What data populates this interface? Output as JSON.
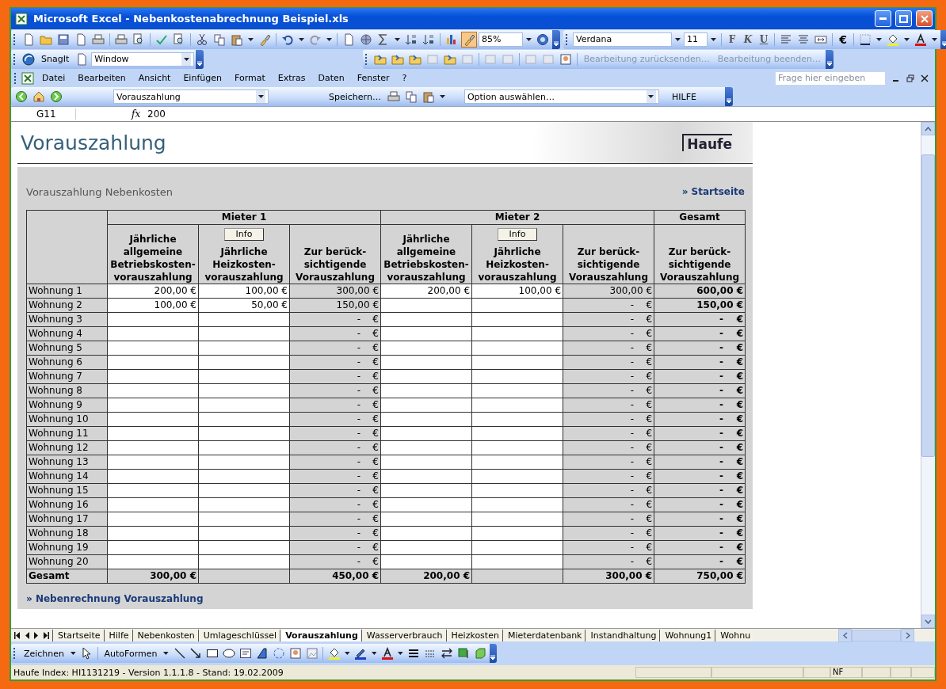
{
  "window": {
    "title": "Microsoft Excel - Nebenkostenabrechnung Beispiel.xls"
  },
  "standard_toolbar": {
    "zoom": "85%",
    "font": "Verdana",
    "font_size": "11",
    "format_buttons": [
      "F",
      "K",
      "U"
    ],
    "currency": "€"
  },
  "snagit_toolbar": {
    "label": "SnagIt",
    "field": "Window"
  },
  "review_toolbar": {
    "actions": [
      {
        "label": "Bearbeitung zurücksenden…",
        "disabled": true
      },
      {
        "label": "Bearbeitung beenden…",
        "disabled": true
      }
    ]
  },
  "menu": {
    "items": [
      "Datei",
      "Bearbeiten",
      "Ansicht",
      "Einfügen",
      "Format",
      "Extras",
      "Daten",
      "Fenster",
      "?"
    ],
    "help_box": {
      "placeholder": "Frage hier eingeben"
    }
  },
  "nav_toolbar": {
    "sheet_select": "Vorauszahlung",
    "save": "Speichern…",
    "option_select": "Option auswählen…",
    "help": "HILFE"
  },
  "formula_bar": {
    "name_box": "G11",
    "fx": "fx",
    "value": "200"
  },
  "sheet": {
    "title": "Vorauszahlung",
    "logo": "Haufe",
    "subtitle": "Vorauszahlung Nebenkosten",
    "start_link": "» Startseite",
    "groups": [
      {
        "label": "Mieter 1",
        "columns": [
          {
            "header": "Jährliche\nallgemeine\nBetriebskosten-\nvorauszahlung",
            "kind": "input"
          },
          {
            "header": "Jährliche\nHeizkosten-\nvorauszahlung",
            "kind": "input",
            "info": "Info"
          },
          {
            "header": "Zur berück-\nsichtigende\nVorauszahlung",
            "kind": "sum"
          }
        ]
      },
      {
        "label": "Mieter 2",
        "columns": [
          {
            "header": "Jährliche\nallgemeine\nBetriebskosten-\nvorauszahlung",
            "kind": "input"
          },
          {
            "header": "Jährliche\nHeizkosten-\nvorauszahlung",
            "kind": "input",
            "info": "Info"
          },
          {
            "header": "Zur berück-\nsichtigende\nVorauszahlung",
            "kind": "sum"
          }
        ]
      },
      {
        "label": "Gesamt",
        "columns": [
          {
            "header": "Zur berück-\nsichtigende\nVorauszahlung",
            "kind": "total"
          }
        ]
      }
    ],
    "rows": [
      {
        "label": "Wohnung 1",
        "cells": [
          "200,00 €",
          "100,00 €",
          "300,00 €",
          "200,00 €",
          "100,00 €",
          "300,00 €",
          "600,00 €"
        ]
      },
      {
        "label": "Wohnung 2",
        "cells": [
          "100,00 €",
          "50,00 €",
          "150,00 €",
          null,
          null,
          "-    €",
          "150,00 €"
        ]
      },
      {
        "label": "Wohnung 3",
        "cells": [
          null,
          null,
          "-    €",
          null,
          null,
          "-    €",
          "-    €"
        ]
      },
      {
        "label": "Wohnung 4",
        "cells": [
          null,
          null,
          "-    €",
          null,
          null,
          "-    €",
          "-    €"
        ]
      },
      {
        "label": "Wohnung 5",
        "cells": [
          null,
          null,
          "-    €",
          null,
          null,
          "-    €",
          "-    €"
        ]
      },
      {
        "label": "Wohnung 6",
        "cells": [
          null,
          null,
          "-    €",
          null,
          null,
          "-    €",
          "-    €"
        ]
      },
      {
        "label": "Wohnung 7",
        "cells": [
          null,
          null,
          "-    €",
          null,
          null,
          "-    €",
          "-    €"
        ]
      },
      {
        "label": "Wohnung 8",
        "cells": [
          null,
          null,
          "-    €",
          null,
          null,
          "-    €",
          "-    €"
        ]
      },
      {
        "label": "Wohnung 9",
        "cells": [
          null,
          null,
          "-    €",
          null,
          null,
          "-    €",
          "-    €"
        ]
      },
      {
        "label": "Wohnung 10",
        "cells": [
          null,
          null,
          "-    €",
          null,
          null,
          "-    €",
          "-    €"
        ]
      },
      {
        "label": "Wohnung 11",
        "cells": [
          null,
          null,
          "-    €",
          null,
          null,
          "-    €",
          "-    €"
        ]
      },
      {
        "label": "Wohnung 12",
        "cells": [
          null,
          null,
          "-    €",
          null,
          null,
          "-    €",
          "-    €"
        ]
      },
      {
        "label": "Wohnung 13",
        "cells": [
          null,
          null,
          "-    €",
          null,
          null,
          "-    €",
          "-    €"
        ]
      },
      {
        "label": "Wohnung 14",
        "cells": [
          null,
          null,
          "-    €",
          null,
          null,
          "-    €",
          "-    €"
        ]
      },
      {
        "label": "Wohnung 15",
        "cells": [
          null,
          null,
          "-    €",
          null,
          null,
          "-    €",
          "-    €"
        ]
      },
      {
        "label": "Wohnung 16",
        "cells": [
          null,
          null,
          "-    €",
          null,
          null,
          "-    €",
          "-    €"
        ]
      },
      {
        "label": "Wohnung 17",
        "cells": [
          null,
          null,
          "-    €",
          null,
          null,
          "-    €",
          "-    €"
        ]
      },
      {
        "label": "Wohnung 18",
        "cells": [
          null,
          null,
          "-    €",
          null,
          null,
          "-    €",
          "-    €"
        ]
      },
      {
        "label": "Wohnung 19",
        "cells": [
          null,
          null,
          "-    €",
          null,
          null,
          "-    €",
          "-    €"
        ]
      },
      {
        "label": "Wohnung 20",
        "cells": [
          null,
          null,
          "-    €",
          null,
          null,
          "-    €",
          "-    €"
        ]
      }
    ],
    "total_row": {
      "label": "Gesamt",
      "cells": [
        "300,00 €",
        null,
        "450,00 €",
        "200,00 €",
        null,
        "300,00 €",
        "750,00 €"
      ]
    },
    "footer_link": "» Nebenrechnung Vorauszahlung"
  },
  "sheet_tabs": [
    {
      "label": "Startseite",
      "selected": false
    },
    {
      "label": "Hilfe",
      "selected": false
    },
    {
      "label": "Nebenkosten",
      "selected": false
    },
    {
      "label": "Umlageschlüssel",
      "selected": false
    },
    {
      "label": "Vorauszahlung",
      "selected": true
    },
    {
      "label": "Wasserverbrauch",
      "selected": false
    },
    {
      "label": "Heizkosten",
      "selected": false
    },
    {
      "label": "Mieterdatenbank",
      "selected": false
    },
    {
      "label": "Instandhaltung",
      "selected": false
    },
    {
      "label": "Wohnung1",
      "selected": false
    },
    {
      "label": "Wohnu",
      "selected": false
    }
  ],
  "drawing_toolbar": {
    "draw": "Zeichnen",
    "autoshapes": "AutoFormen"
  },
  "status_bar": {
    "text": "Haufe Index: HI1131219 - Version 1.1.1.8 - Stand: 19.02.2009",
    "indicator": "NF"
  }
}
